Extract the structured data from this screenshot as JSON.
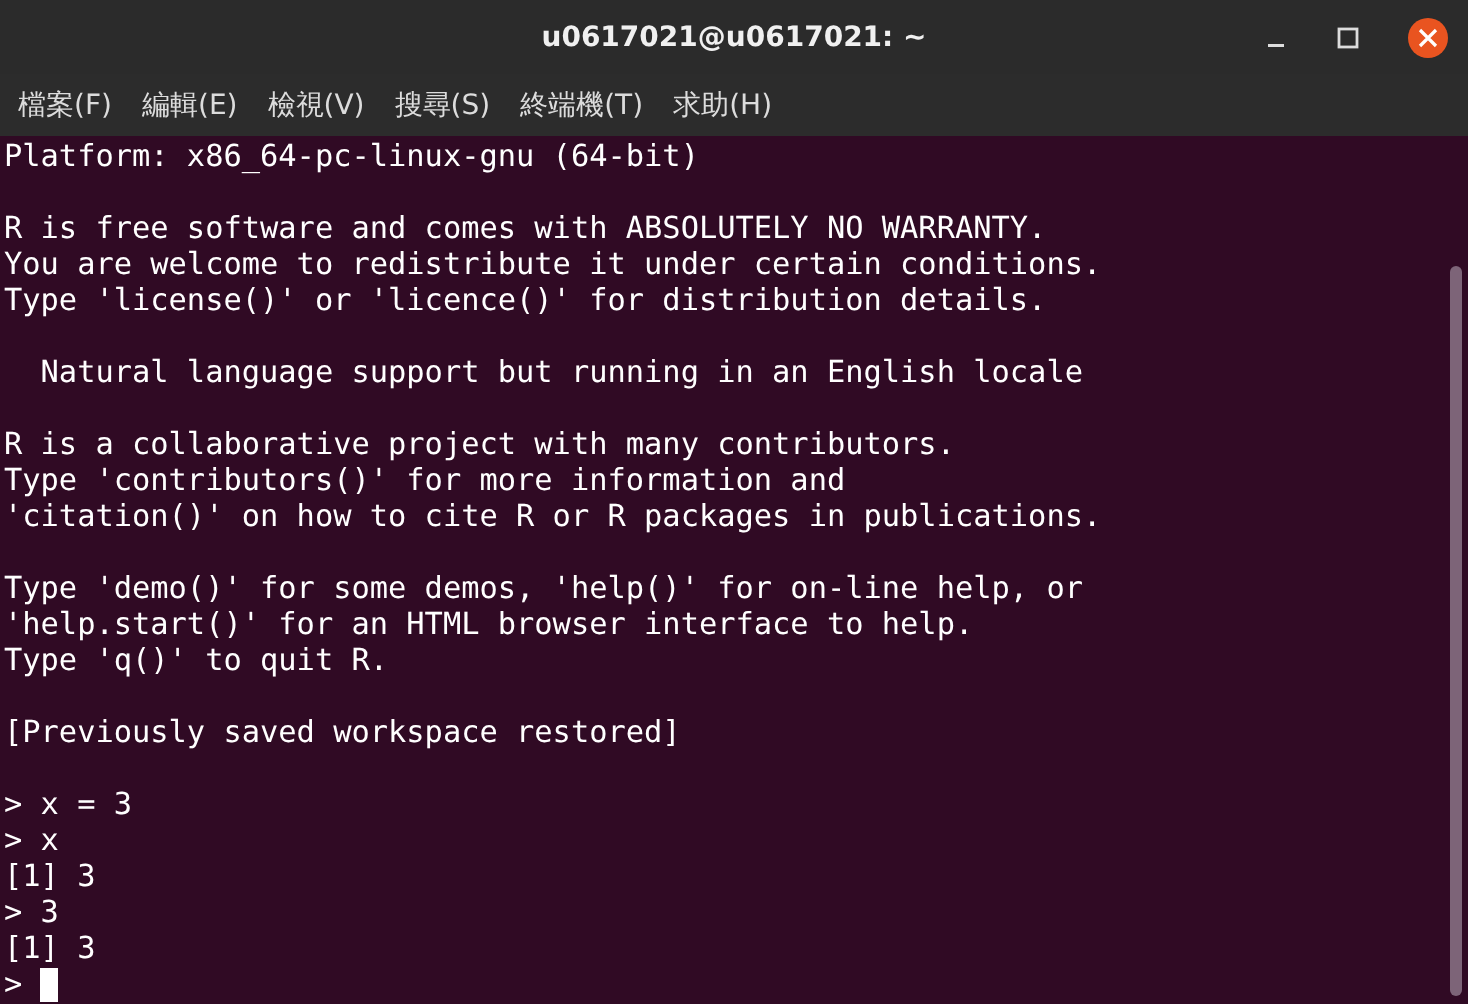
{
  "window": {
    "title": "u0617021@u0617021: ~"
  },
  "menu": [
    "檔案(F)",
    "編輯(E)",
    "檢視(V)",
    "搜尋(S)",
    "終端機(T)",
    "求助(H)"
  ],
  "terminal": {
    "blocks": [
      [
        "Platform: x86_64-pc-linux-gnu (64-bit)"
      ],
      [
        "R is free software and comes with ABSOLUTELY NO WARRANTY.",
        "You are welcome to redistribute it under certain conditions.",
        "Type 'license()' or 'licence()' for distribution details."
      ],
      [
        "  Natural language support but running in an English locale"
      ],
      [
        "R is a collaborative project with many contributors.",
        "Type 'contributors()' for more information and",
        "'citation()' on how to cite R or R packages in publications."
      ],
      [
        "Type 'demo()' for some demos, 'help()' for on-line help, or",
        "'help.start()' for an HTML browser interface to help.",
        "Type 'q()' to quit R."
      ],
      [
        "[Previously saved workspace restored]"
      ],
      [
        "> x = 3",
        "> x",
        "[1] 3",
        "> 3",
        "[1] 3"
      ]
    ],
    "prompt": ">",
    "cursor": true
  }
}
